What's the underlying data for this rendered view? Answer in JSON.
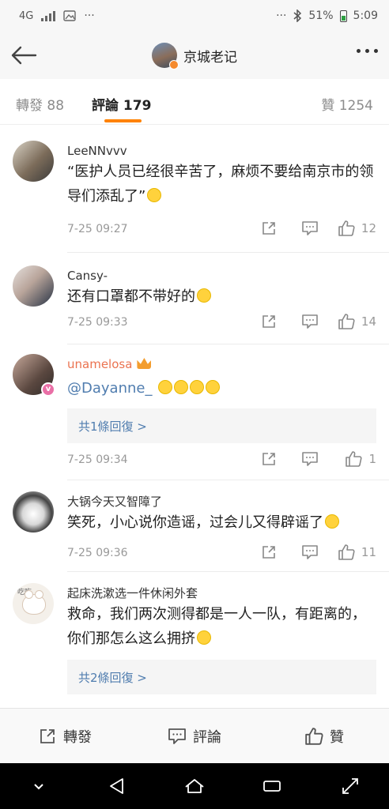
{
  "status_bar": {
    "network": "4G",
    "more": "···",
    "more_right": "···",
    "battery": "51%",
    "time": "5:09"
  },
  "nav": {
    "title": "京城老记"
  },
  "tabs": {
    "repost_label": "轉發",
    "repost_count": "88",
    "comments_label": "評論",
    "comments_count": "179",
    "likes_label": "贊",
    "likes_count": "1254"
  },
  "comments": [
    {
      "name": "LeeNNvvv",
      "text": "“医护人员已经很辛苦了，麻烦不要给南京市的领导们添乱了”",
      "time": "7-25 09:27",
      "likes": "12"
    },
    {
      "name": "Cansy-",
      "text": "还有口罩都不带好的",
      "time": "7-25 09:33",
      "likes": "14"
    },
    {
      "name": "unamelosa",
      "text": "@Dayanne_",
      "reply": "共1條回復 >",
      "time": "7-25 09:34",
      "likes": "1"
    },
    {
      "name": "大锅今天又智障了",
      "text": "笑死，小心说你造谣，过会儿又得辟谣了",
      "time": "7-25 09:36",
      "likes": "11"
    },
    {
      "name": "起床洗漱选一件休闲外套",
      "text": "救命，我们两次测得都是一人一队，有距离的，你们那怎么这么拥挤",
      "reply": "共2條回復 >",
      "avatar_tag": "吃吃"
    }
  ],
  "toolbar": {
    "repost": "轉發",
    "comment": "評論",
    "like": "贊"
  },
  "icons": {
    "back": "back-arrow-icon",
    "more": "more-dots-icon",
    "share": "share-icon",
    "reply": "comment-icon",
    "like": "thumbs-up-icon"
  },
  "colors": {
    "accent": "#ff8200",
    "link": "#507daf",
    "vip_name": "#eb7350"
  }
}
